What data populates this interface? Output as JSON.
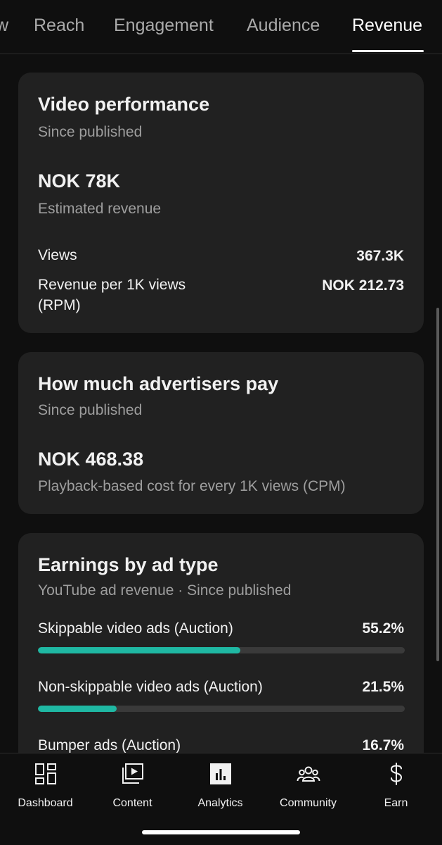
{
  "tabs": [
    {
      "label": "w",
      "active": false
    },
    {
      "label": "Reach",
      "active": false
    },
    {
      "label": "Engagement",
      "active": false
    },
    {
      "label": "Audience",
      "active": false
    },
    {
      "label": "Revenue",
      "active": true
    }
  ],
  "video_performance": {
    "title": "Video performance",
    "subtitle": "Since published",
    "value": "NOK 78K",
    "value_label": "Estimated revenue",
    "metrics": [
      {
        "label": "Views",
        "value": "367.3K"
      },
      {
        "label": "Revenue per 1K views (RPM)",
        "value": "NOK 212.73"
      }
    ]
  },
  "advertisers": {
    "title": "How much advertisers pay",
    "subtitle": "Since published",
    "value": "NOK 468.38",
    "value_label": "Playback-based cost for every 1K views (CPM)"
  },
  "earnings": {
    "title": "Earnings by ad type",
    "subtitle": "YouTube ad revenue · Since published",
    "accent_color": "#1fb8a3",
    "items": [
      {
        "label": "Skippable video ads (Auction)",
        "percent": "55.2%",
        "fraction": 0.552
      },
      {
        "label": "Non-skippable video ads (Auction)",
        "percent": "21.5%",
        "fraction": 0.215
      },
      {
        "label": "Bumper ads (Auction)",
        "percent": "16.7%",
        "fraction": 0.167
      }
    ]
  },
  "bottom_nav": [
    {
      "label": "Dashboard",
      "icon": "dashboard-icon",
      "active": false
    },
    {
      "label": "Content",
      "icon": "content-icon",
      "active": false
    },
    {
      "label": "Analytics",
      "icon": "analytics-icon",
      "active": true
    },
    {
      "label": "Community",
      "icon": "community-icon",
      "active": false
    },
    {
      "label": "Earn",
      "icon": "earn-icon",
      "active": false
    }
  ]
}
